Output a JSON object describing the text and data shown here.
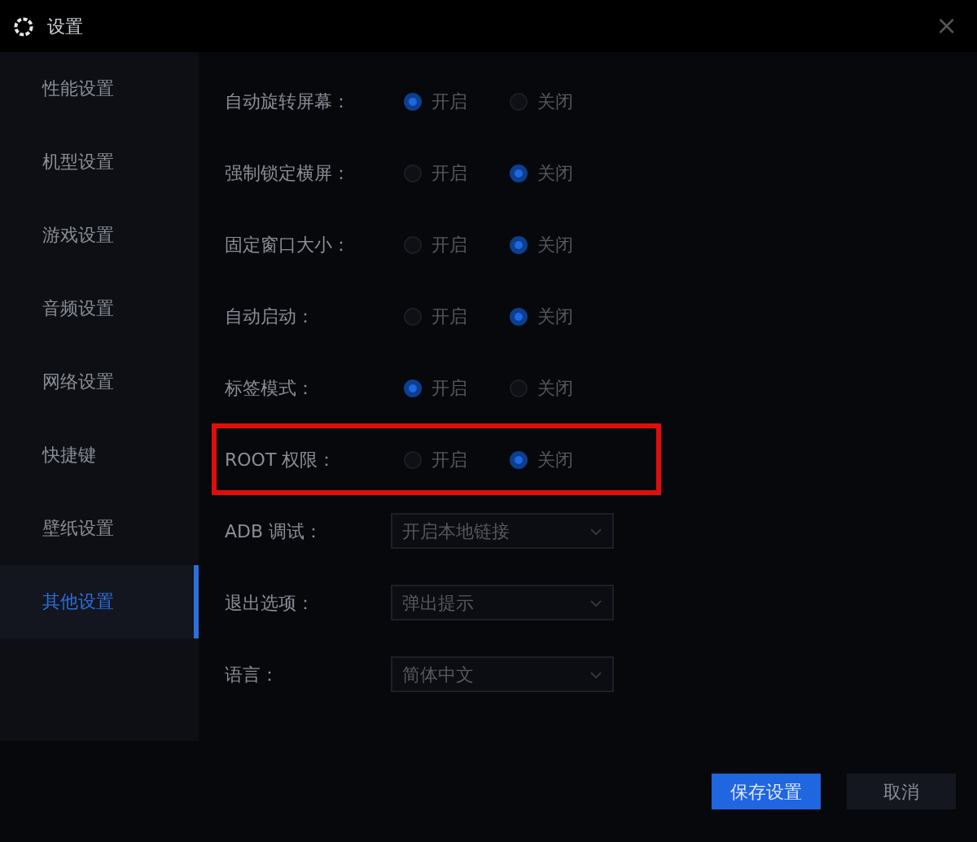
{
  "window": {
    "title": "设置",
    "close": "×"
  },
  "sidebar": {
    "items": [
      {
        "label": "性能设置",
        "selected": false
      },
      {
        "label": "机型设置",
        "selected": false
      },
      {
        "label": "游戏设置",
        "selected": false
      },
      {
        "label": "音频设置",
        "selected": false
      },
      {
        "label": "网络设置",
        "selected": false
      },
      {
        "label": "快捷键",
        "selected": false
      },
      {
        "label": "壁纸设置",
        "selected": false
      },
      {
        "label": "其他设置",
        "selected": true
      }
    ]
  },
  "settings": [
    {
      "kind": "radio",
      "label": "自动旋转屏幕：",
      "highlighted": false,
      "options": [
        {
          "label": "开启",
          "selected": true
        },
        {
          "label": "关闭",
          "selected": false
        }
      ]
    },
    {
      "kind": "radio",
      "label": "强制锁定横屏：",
      "highlighted": false,
      "options": [
        {
          "label": "开启",
          "selected": false
        },
        {
          "label": "关闭",
          "selected": true
        }
      ]
    },
    {
      "kind": "radio",
      "label": "固定窗口大小：",
      "highlighted": false,
      "options": [
        {
          "label": "开启",
          "selected": false
        },
        {
          "label": "关闭",
          "selected": true
        }
      ]
    },
    {
      "kind": "radio",
      "label": "自动启动：",
      "highlighted": false,
      "options": [
        {
          "label": "开启",
          "selected": false
        },
        {
          "label": "关闭",
          "selected": true
        }
      ]
    },
    {
      "kind": "radio",
      "label": "标签模式：",
      "highlighted": false,
      "options": [
        {
          "label": "开启",
          "selected": true
        },
        {
          "label": "关闭",
          "selected": false
        }
      ]
    },
    {
      "kind": "radio",
      "label": "ROOT 权限：",
      "highlighted": true,
      "options": [
        {
          "label": "开启",
          "selected": false
        },
        {
          "label": "关闭",
          "selected": true
        }
      ]
    },
    {
      "kind": "select",
      "label": "ADB 调试：",
      "highlighted": false,
      "value": "开启本地链接"
    },
    {
      "kind": "select",
      "label": "退出选项：",
      "highlighted": false,
      "value": "弹出提示"
    },
    {
      "kind": "select",
      "label": "语言：",
      "highlighted": false,
      "value": "简体中文"
    }
  ],
  "buttons": [
    {
      "label": "保存设置",
      "kind": "primary"
    },
    {
      "label": "取消",
      "kind": "secondary"
    }
  ]
}
